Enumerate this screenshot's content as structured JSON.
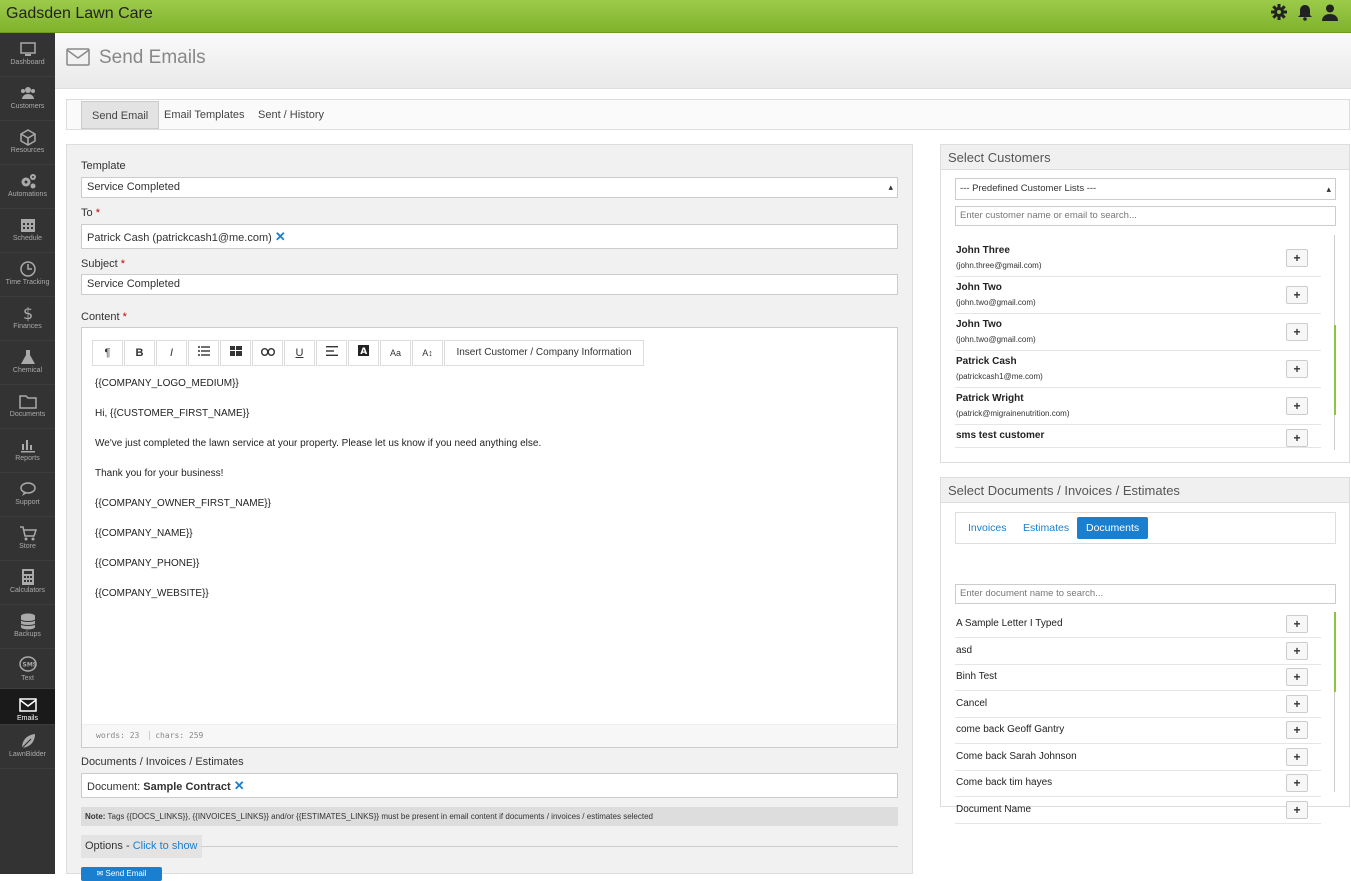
{
  "app": {
    "title": "Gadsden Lawn Care"
  },
  "sidebar": {
    "items": [
      {
        "label": "Dashboard",
        "icon": "monitor-icon"
      },
      {
        "label": "Customers",
        "icon": "users-icon"
      },
      {
        "label": "Resources",
        "icon": "cube-icon"
      },
      {
        "label": "Automations",
        "icon": "cogs-icon"
      },
      {
        "label": "Schedule",
        "icon": "calendar-icon"
      },
      {
        "label": "Time Tracking",
        "icon": "clock-icon"
      },
      {
        "label": "Finances",
        "icon": "dollar-icon"
      },
      {
        "label": "Chemical",
        "icon": "flask-icon"
      },
      {
        "label": "Documents",
        "icon": "folder-icon"
      },
      {
        "label": "Reports",
        "icon": "bar-chart-icon"
      },
      {
        "label": "Support",
        "icon": "chat-icon"
      },
      {
        "label": "Store",
        "icon": "cart-icon"
      },
      {
        "label": "Calculators",
        "icon": "calculator-icon"
      },
      {
        "label": "Backups",
        "icon": "database-icon"
      },
      {
        "label": "Text",
        "icon": "sms-icon"
      },
      {
        "label": "Emails",
        "icon": "envelope-icon"
      },
      {
        "label": "LawnBidder",
        "icon": "leaf-icon"
      }
    ]
  },
  "page": {
    "title": "Send Emails"
  },
  "tabs": [
    "Send Email",
    "Email Templates",
    "Sent / History"
  ],
  "form": {
    "template_label": "Template",
    "template_value": "Service Completed",
    "to_label": "To",
    "to_value": "Patrick Cash (patrickcash1@me.com)",
    "subject_label": "Subject",
    "subject_value": "Service Completed",
    "content_label": "Content",
    "required_mark": "*",
    "remove_mark": "✕",
    "toolbar": {
      "insert_label": "Insert Customer / Company Information",
      "bold": "B",
      "italic": "I",
      "underline": "U",
      "paragraph": "¶",
      "font_size": "Aa",
      "line_height": "A↕"
    },
    "body": [
      "{{COMPANY_LOGO_MEDIUM}}",
      "Hi, {{CUSTOMER_FIRST_NAME}}",
      "We've just completed the lawn service at your property. Please let us know if you need anything else.",
      "Thank you for your business!",
      "{{COMPANY_OWNER_FIRST_NAME}}",
      "{{COMPANY_NAME}}",
      "{{COMPANY_PHONE}}",
      "{{COMPANY_WEBSITE}}"
    ],
    "words": "words: 23",
    "chars": "chars: 259",
    "docs_label": "Documents / Invoices / Estimates",
    "doc_prefix": "Document:",
    "doc_name": "Sample Contract",
    "note_bold": "Note:",
    "note_text": "Tags {{DOCS_LINKS}}, {{INVOICES_LINKS}} and/or {{ESTIMATES_LINKS}} must be present in email content if documents / invoices / estimates selected",
    "options_label": "Options -",
    "options_link": "Click to show",
    "send_label": "✉ Send Email"
  },
  "customers_panel": {
    "title": "Select Customers",
    "list_select": "--- Predefined Customer Lists ---",
    "search_placeholder": "Enter customer name or email to search...",
    "customers": [
      {
        "name": "John Three",
        "email": "(john.three@gmail.com)"
      },
      {
        "name": "John Two",
        "email": "(john.two@gmail.com)"
      },
      {
        "name": "John Two",
        "email": "(john.two@gmail.com)"
      },
      {
        "name": "Patrick Cash",
        "email": "(patrickcash1@me.com)"
      },
      {
        "name": "Patrick Wright",
        "email": "(patrick@migrainenutrition.com)"
      },
      {
        "name": "sms test customer",
        "email": ""
      }
    ]
  },
  "documents_panel": {
    "title": "Select Documents / Invoices / Estimates",
    "tabs": [
      "Invoices",
      "Estimates",
      "Documents"
    ],
    "active_tab": "Documents",
    "search_placeholder": "Enter document name to search...",
    "documents": [
      "A Sample Letter I Typed",
      "asd",
      "Binh Test",
      "Cancel",
      "come back Geoff Gantry",
      "Come back Sarah Johnson",
      "Come back tim hayes",
      "Document Name"
    ]
  },
  "colors": {
    "brand_green": "#8cc63f",
    "accent_blue": "#1a7fcf",
    "sidebar": "#333333"
  }
}
